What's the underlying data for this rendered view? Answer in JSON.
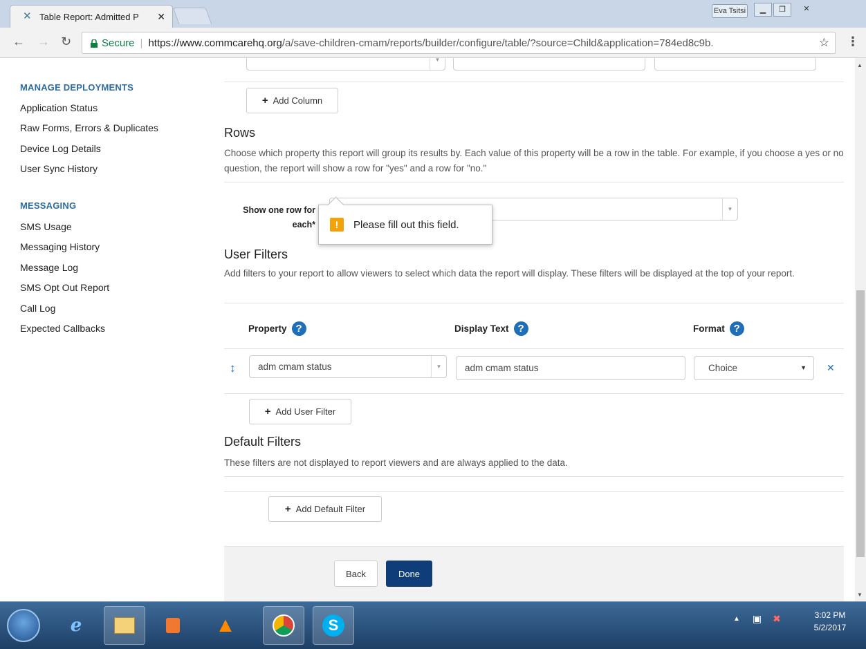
{
  "browser": {
    "tab_title": "Table Report: Admitted P",
    "tab_title_fade": " ",
    "user_name": "Eva Tsitsi",
    "secure_label": "Secure",
    "url_host": "https://www.commcarehq.org",
    "url_path": "/a/save-children-cmam/reports/builder/configure/table/?source=Child&application=784ed8c9b.",
    "icons": {
      "back": "back-arrow-icon",
      "forward": "forward-arrow-icon",
      "reload": "reload-icon",
      "lock": "lock-icon",
      "star": "star-icon",
      "menu": "kebab-menu-icon"
    }
  },
  "sidebar": {
    "sections": [
      {
        "title": "MANAGE DEPLOYMENTS",
        "items": [
          "Application Status",
          "Raw Forms, Errors & Duplicates",
          "Device Log Details",
          "User Sync History"
        ]
      },
      {
        "title": "MESSAGING",
        "items": [
          "SMS Usage",
          "Messaging History",
          "Message Log",
          "SMS Opt Out Report",
          "Call Log",
          "Expected Callbacks"
        ]
      }
    ]
  },
  "columns": {
    "add_column_label": "Add Column"
  },
  "rows": {
    "title": "Rows",
    "description": "Choose which property this report will group its results by. Each value of this property will be a row in the table. For example, if you choose a yes or no question, the report will show a row for \"yes\" and a row for \"no.\"",
    "field_label": "Show one row for each*",
    "field_value": "",
    "validation_message": "Please fill out this field."
  },
  "user_filters": {
    "title": "User Filters",
    "description": "Add filters to your report to allow viewers to select which data the report will display. These filters will be displayed at the top of your report.",
    "headers": {
      "property": "Property",
      "display_text": "Display Text",
      "format": "Format"
    },
    "rows": [
      {
        "property": "adm cmam status",
        "display_text": "adm cmam status",
        "format": "Choice"
      }
    ],
    "add_label": "Add User Filter"
  },
  "default_filters": {
    "title": "Default Filters",
    "description": "These filters are not displayed to report viewers and are always applied to the data.",
    "add_label": "Add Default Filter"
  },
  "footer": {
    "back_label": "Back",
    "done_label": "Done"
  },
  "taskbar": {
    "apps": [
      "start-orb",
      "internet-explorer-icon",
      "file-explorer-icon",
      "media-player-icon",
      "vlc-icon",
      "chrome-icon",
      "skype-icon"
    ],
    "time": "3:02 PM",
    "date": "5/2/2017"
  },
  "colors": {
    "link_blue": "#2d6ca2",
    "help_blue": "#1e6fb8",
    "primary_button": "#0f3d7a",
    "warning": "#f0a30a",
    "secure_green": "#0b8043"
  }
}
